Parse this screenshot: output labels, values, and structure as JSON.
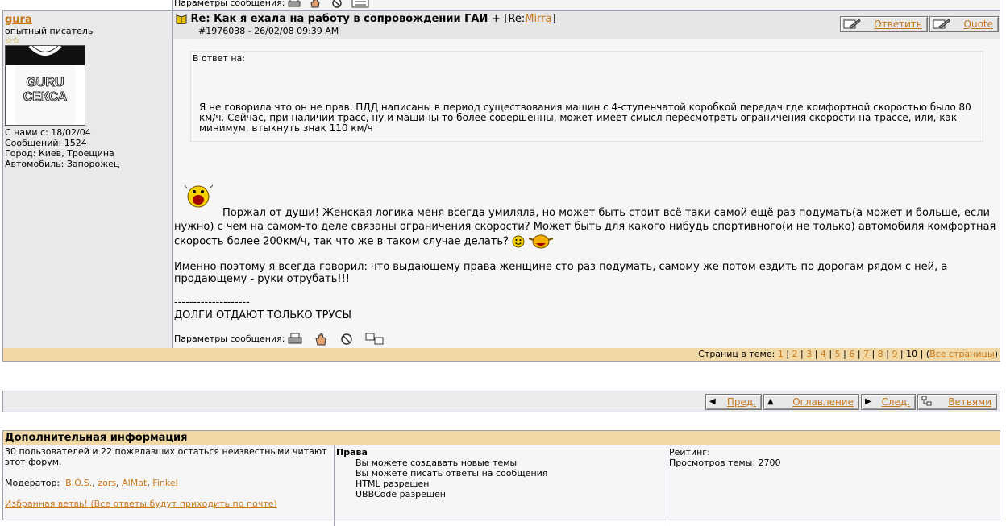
{
  "top_strip": {
    "message_params_label": "Параметры сообщения:"
  },
  "post": {
    "author": {
      "username": "gura",
      "user_title": "опытный писатель",
      "stars": "☆☆",
      "avatar_text_line1": "GURU",
      "avatar_text_line2": "СЕКСА",
      "joined": "С нами с: 18/02/04",
      "messages": "Сообщений: 1524",
      "city": "Город: Киев, Троещина",
      "car": "Автомобиль: Запорожец"
    },
    "subject": "Re: Как я ехала на работу в сопровождении ГАИ",
    "subject_plus": "+",
    "reply_to_prefix": "[Re:",
    "reply_to_user": "Mirra",
    "reply_to_suffix": "]",
    "post_id_date": "#1976038 - 26/02/08 09:39 AM",
    "reply_button": "Ответить",
    "quote_button": "Quote",
    "quote_label": "В ответ на:",
    "quote_text": "Я не говорила что он не прав. ПДД написаны в период существования машин с 4-ступенчатой коробкой передач где комфортной скоростью было 80 км/ч. Сейчас, при наличии трасс, ну и машины то более совершенны, может имеет смысл пересмотреть ограничения скорости на трассе, или, как минимум, втыкнуть знак 110 км/ч",
    "reply_text": "Поржал от души! Женская логика меня всегда умиляла, но может быть стоит всё таки самой ещё раз подумать(а может и больше, если нужно) с чем на самом-то деле связаны ограничения скорости? Может быть для какого нибудь спортивного(и не только) автомобиля комфортная скорость более 200км/ч, так что же в таком случае делать?",
    "reply_text2": "Именно поэтому я всегда говорил: что выдающему права женщине сто раз подумать, самому же потом ездить по дорогам рядом с ней, а продающему - руки отрубать!!!",
    "signature_line": "--------------------",
    "signature": "ДОЛГИ ОТДАЮТ ТОЛЬКО ТРУСЫ",
    "message_params_label": "Параметры сообщения:"
  },
  "pagination": {
    "label": "Страниц в теме:",
    "pages": [
      "1",
      "2",
      "3",
      "4",
      "5",
      "6",
      "7",
      "8",
      "9"
    ],
    "current": "10",
    "all_pages": "Все страницы"
  },
  "nav": {
    "prev": "Пред.",
    "contents": "Оглавление",
    "next": "След.",
    "threads": "Ветвями"
  },
  "info": {
    "title": "Дополнительная информация",
    "readers": "30 пользователей и 22 пожелавших остаться неизвестными читают",
    "readers2": "этот форум.",
    "moderator_label": "Модератор:",
    "moderators": [
      "B.O.S.",
      "zors",
      "AlMat",
      "Finkel"
    ],
    "favorite": "Избранная ветвь! (Все ответы будут приходить по почте)",
    "rights_title": "Права",
    "rights": [
      "Вы можете создавать новые темы",
      "Вы можете писать ответы на сообщения",
      "HTML разрешен",
      "UBBCode разрешен"
    ],
    "rating": "Рейтинг:",
    "views": "Просмотров темы: 2700"
  }
}
